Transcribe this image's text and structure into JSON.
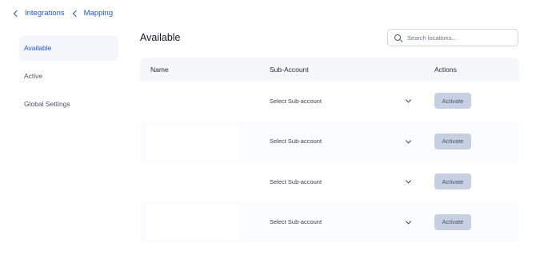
{
  "breadcrumb": {
    "items": [
      "Integrations",
      "Mapping"
    ]
  },
  "sidebar": {
    "items": [
      {
        "label": "Available"
      },
      {
        "label": "Active"
      },
      {
        "label": "Global Settings"
      }
    ]
  },
  "main": {
    "title": "Available",
    "search": {
      "placeholder": "Search locations..."
    },
    "table": {
      "columns": [
        "Name",
        "Sub-Account",
        "Actions"
      ],
      "rows": [
        {
          "name": "",
          "sub_account": "Select Sub-account",
          "action": "Activate"
        },
        {
          "name": "",
          "sub_account": "Select Sub-account",
          "action": "Activate"
        },
        {
          "name": "",
          "sub_account": "Select Sub-account",
          "action": "Activate"
        },
        {
          "name": "",
          "sub_account": "Select Sub-account",
          "action": "Activate"
        }
      ]
    }
  },
  "colors": {
    "accent": "#2456d6",
    "button_bg": "#c6d0e0",
    "header_bg": "#f5f7fb",
    "active_item_bg": "#f4f6fb"
  },
  "icons": {
    "back": "chevron-left-icon",
    "search": "search-icon",
    "select": "chevron-down-icon"
  }
}
